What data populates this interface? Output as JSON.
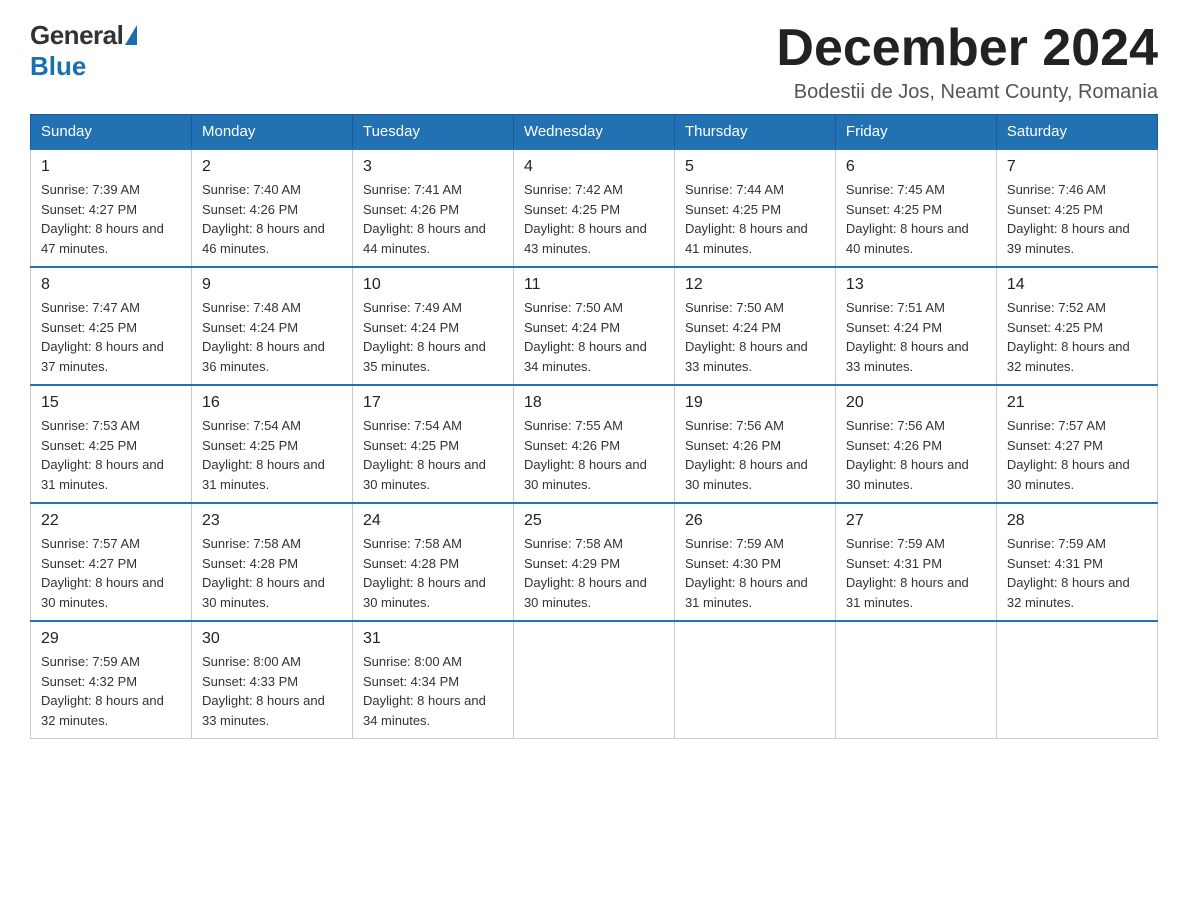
{
  "header": {
    "logo_general": "General",
    "logo_blue": "Blue",
    "month_title": "December 2024",
    "location": "Bodestii de Jos, Neamt County, Romania"
  },
  "weekdays": [
    "Sunday",
    "Monday",
    "Tuesday",
    "Wednesday",
    "Thursday",
    "Friday",
    "Saturday"
  ],
  "weeks": [
    [
      {
        "day": "1",
        "sunrise": "7:39 AM",
        "sunset": "4:27 PM",
        "daylight": "8 hours and 47 minutes."
      },
      {
        "day": "2",
        "sunrise": "7:40 AM",
        "sunset": "4:26 PM",
        "daylight": "8 hours and 46 minutes."
      },
      {
        "day": "3",
        "sunrise": "7:41 AM",
        "sunset": "4:26 PM",
        "daylight": "8 hours and 44 minutes."
      },
      {
        "day": "4",
        "sunrise": "7:42 AM",
        "sunset": "4:25 PM",
        "daylight": "8 hours and 43 minutes."
      },
      {
        "day": "5",
        "sunrise": "7:44 AM",
        "sunset": "4:25 PM",
        "daylight": "8 hours and 41 minutes."
      },
      {
        "day": "6",
        "sunrise": "7:45 AM",
        "sunset": "4:25 PM",
        "daylight": "8 hours and 40 minutes."
      },
      {
        "day": "7",
        "sunrise": "7:46 AM",
        "sunset": "4:25 PM",
        "daylight": "8 hours and 39 minutes."
      }
    ],
    [
      {
        "day": "8",
        "sunrise": "7:47 AM",
        "sunset": "4:25 PM",
        "daylight": "8 hours and 37 minutes."
      },
      {
        "day": "9",
        "sunrise": "7:48 AM",
        "sunset": "4:24 PM",
        "daylight": "8 hours and 36 minutes."
      },
      {
        "day": "10",
        "sunrise": "7:49 AM",
        "sunset": "4:24 PM",
        "daylight": "8 hours and 35 minutes."
      },
      {
        "day": "11",
        "sunrise": "7:50 AM",
        "sunset": "4:24 PM",
        "daylight": "8 hours and 34 minutes."
      },
      {
        "day": "12",
        "sunrise": "7:50 AM",
        "sunset": "4:24 PM",
        "daylight": "8 hours and 33 minutes."
      },
      {
        "day": "13",
        "sunrise": "7:51 AM",
        "sunset": "4:24 PM",
        "daylight": "8 hours and 33 minutes."
      },
      {
        "day": "14",
        "sunrise": "7:52 AM",
        "sunset": "4:25 PM",
        "daylight": "8 hours and 32 minutes."
      }
    ],
    [
      {
        "day": "15",
        "sunrise": "7:53 AM",
        "sunset": "4:25 PM",
        "daylight": "8 hours and 31 minutes."
      },
      {
        "day": "16",
        "sunrise": "7:54 AM",
        "sunset": "4:25 PM",
        "daylight": "8 hours and 31 minutes."
      },
      {
        "day": "17",
        "sunrise": "7:54 AM",
        "sunset": "4:25 PM",
        "daylight": "8 hours and 30 minutes."
      },
      {
        "day": "18",
        "sunrise": "7:55 AM",
        "sunset": "4:26 PM",
        "daylight": "8 hours and 30 minutes."
      },
      {
        "day": "19",
        "sunrise": "7:56 AM",
        "sunset": "4:26 PM",
        "daylight": "8 hours and 30 minutes."
      },
      {
        "day": "20",
        "sunrise": "7:56 AM",
        "sunset": "4:26 PM",
        "daylight": "8 hours and 30 minutes."
      },
      {
        "day": "21",
        "sunrise": "7:57 AM",
        "sunset": "4:27 PM",
        "daylight": "8 hours and 30 minutes."
      }
    ],
    [
      {
        "day": "22",
        "sunrise": "7:57 AM",
        "sunset": "4:27 PM",
        "daylight": "8 hours and 30 minutes."
      },
      {
        "day": "23",
        "sunrise": "7:58 AM",
        "sunset": "4:28 PM",
        "daylight": "8 hours and 30 minutes."
      },
      {
        "day": "24",
        "sunrise": "7:58 AM",
        "sunset": "4:28 PM",
        "daylight": "8 hours and 30 minutes."
      },
      {
        "day": "25",
        "sunrise": "7:58 AM",
        "sunset": "4:29 PM",
        "daylight": "8 hours and 30 minutes."
      },
      {
        "day": "26",
        "sunrise": "7:59 AM",
        "sunset": "4:30 PM",
        "daylight": "8 hours and 31 minutes."
      },
      {
        "day": "27",
        "sunrise": "7:59 AM",
        "sunset": "4:31 PM",
        "daylight": "8 hours and 31 minutes."
      },
      {
        "day": "28",
        "sunrise": "7:59 AM",
        "sunset": "4:31 PM",
        "daylight": "8 hours and 32 minutes."
      }
    ],
    [
      {
        "day": "29",
        "sunrise": "7:59 AM",
        "sunset": "4:32 PM",
        "daylight": "8 hours and 32 minutes."
      },
      {
        "day": "30",
        "sunrise": "8:00 AM",
        "sunset": "4:33 PM",
        "daylight": "8 hours and 33 minutes."
      },
      {
        "day": "31",
        "sunrise": "8:00 AM",
        "sunset": "4:34 PM",
        "daylight": "8 hours and 34 minutes."
      },
      null,
      null,
      null,
      null
    ]
  ]
}
